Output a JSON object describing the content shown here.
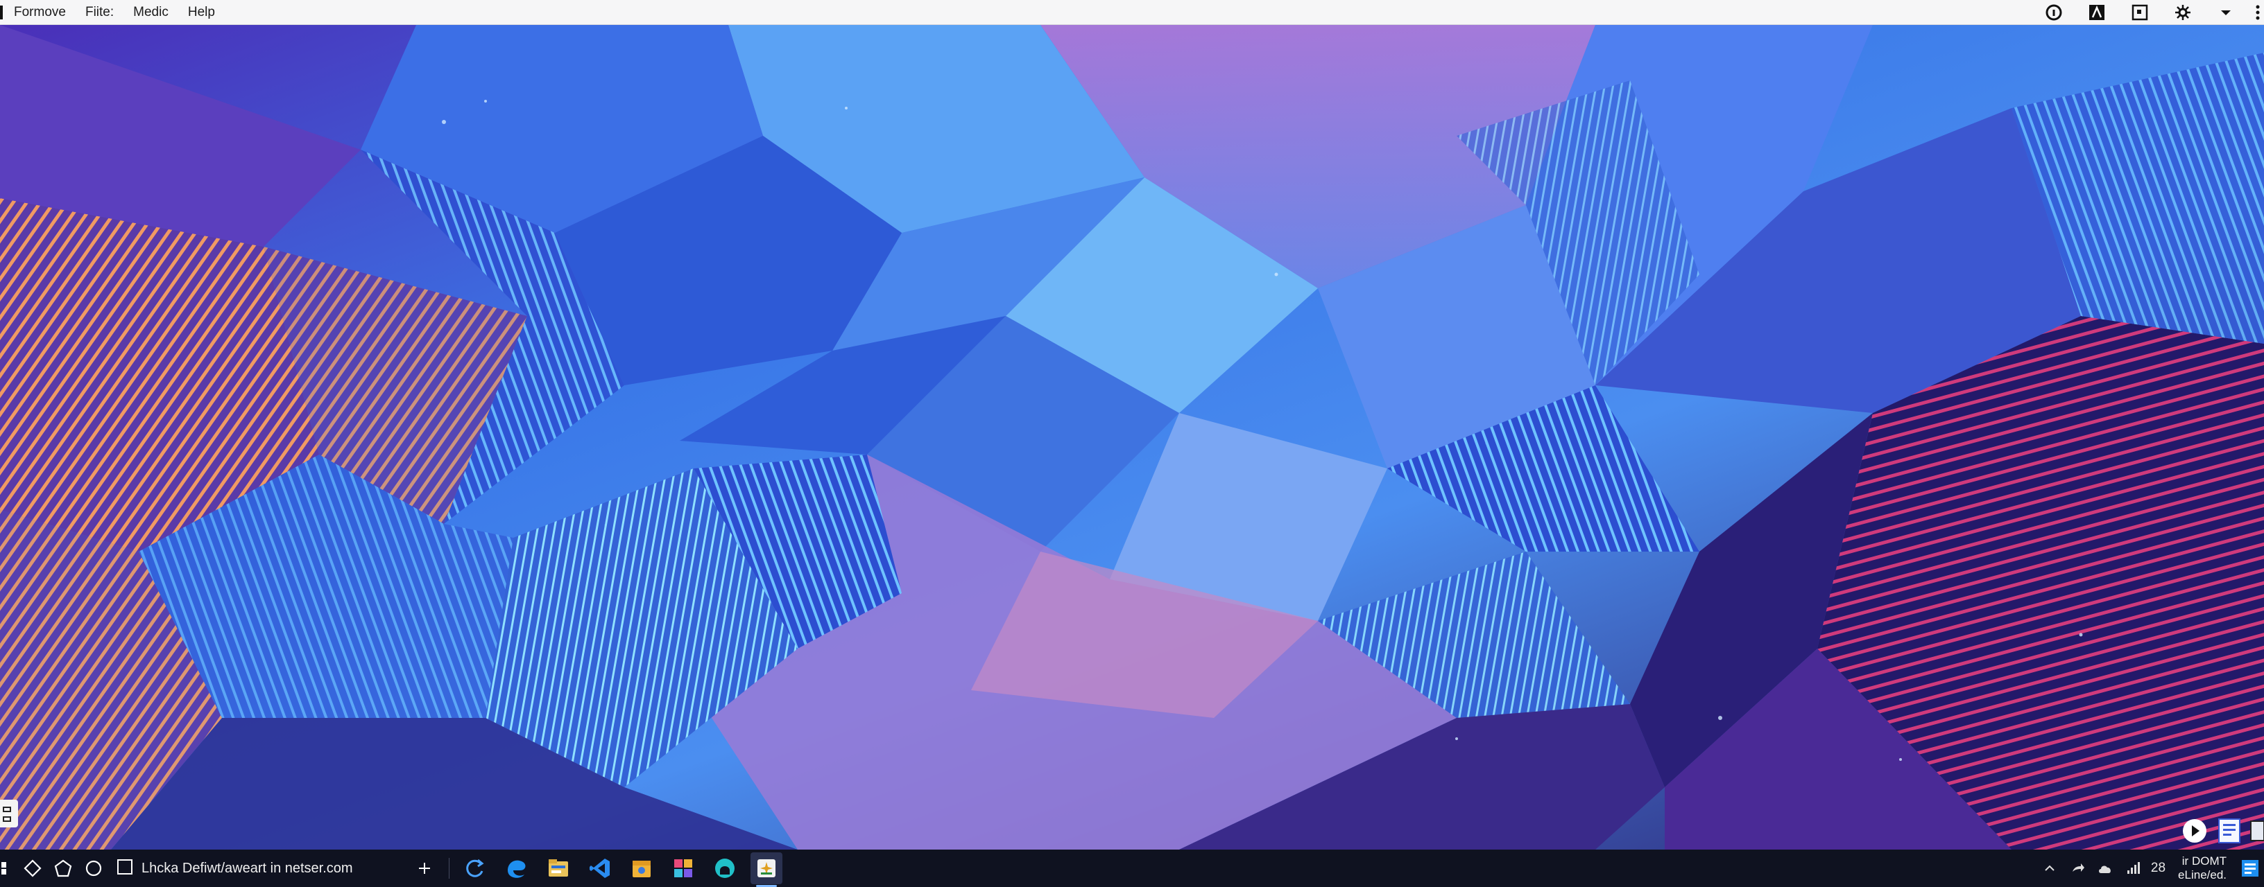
{
  "menubar": {
    "items": [
      "Formove",
      "Fiite:",
      "Medic",
      "Help"
    ],
    "tray_icons": [
      "info-circle-icon",
      "text-a-icon",
      "square-window-icon",
      "settings-gear-icon",
      "caret-down-icon",
      "more-vertical-icon"
    ]
  },
  "desktop": {
    "wallpaper": "abstract low-poly blue purple wallpaper",
    "colors": {
      "deep": "#1a1f5e",
      "blue": "#3a63e0",
      "sky": "#5aa9f0",
      "violet": "#6a3fc0",
      "magenta": "#c23a78",
      "orange": "#e98a55"
    }
  },
  "taskbar": {
    "start_icon": "windows-start-icon",
    "left_icons": [
      "diamond-icon",
      "pentagon-icon",
      "circle-icon"
    ],
    "search_text": "Lhcka Defiwt/aweart in netser.com",
    "add_icon": "plus-icon",
    "apps": [
      "refresh-app-icon",
      "edge-browser-icon",
      "file-explorer-icon",
      "vscode-icon",
      "package-icon",
      "photos-icon",
      "teams-icon",
      "active-window-icon"
    ],
    "tray": {
      "items": [
        "chevron-up-icon",
        "share-icon",
        "cloud-icon",
        "network-icon"
      ],
      "number": "28",
      "clock_line1": "ir DOMT",
      "clock_line2": "eLine/ed.",
      "notification_icon": "notification-icon"
    }
  }
}
